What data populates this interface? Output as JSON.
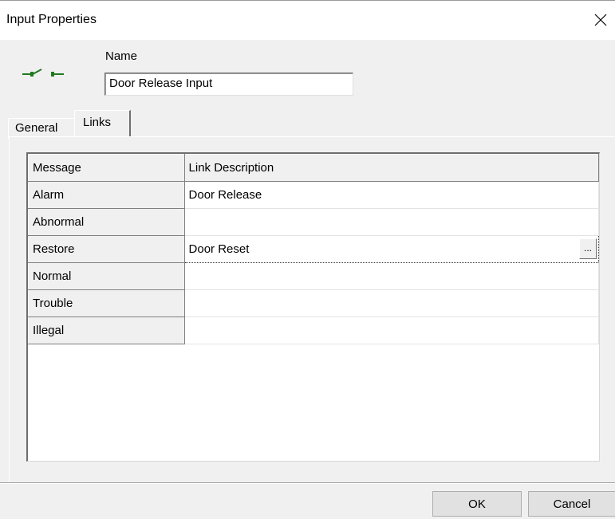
{
  "window": {
    "title": "Input Properties",
    "close_icon": "close-icon"
  },
  "header": {
    "icon": "switch-icon",
    "name_label": "Name",
    "name_value": "Door Release Input"
  },
  "tabs": [
    {
      "label": "General",
      "active": false
    },
    {
      "label": "Links",
      "active": true
    }
  ],
  "links_table": {
    "columns": [
      "Message",
      "Link Description"
    ],
    "rows": [
      {
        "message": "Alarm",
        "link": "Door Release"
      },
      {
        "message": "Abnormal",
        "link": ""
      },
      {
        "message": "Restore",
        "link": "Door Reset"
      },
      {
        "message": "Normal",
        "link": ""
      },
      {
        "message": "Trouble",
        "link": ""
      },
      {
        "message": "Illegal",
        "link": ""
      }
    ],
    "browse_label": "..."
  },
  "footer": {
    "ok_label": "OK",
    "cancel_label": "Cancel"
  },
  "colors": {
    "icon_green": "#1e7a1e"
  }
}
